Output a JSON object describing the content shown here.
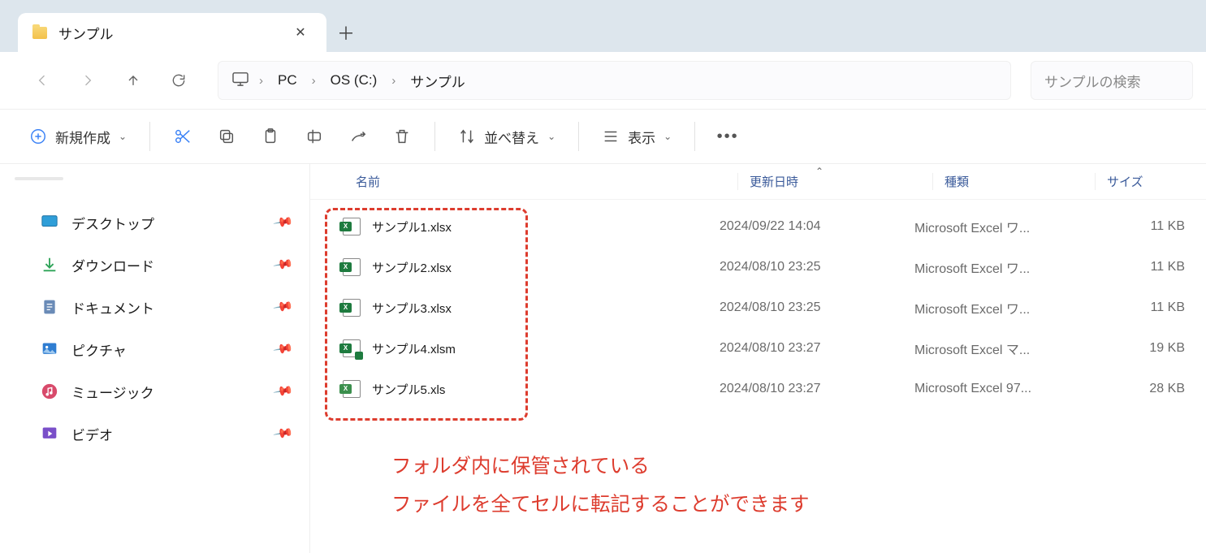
{
  "tab": {
    "title": "サンプル"
  },
  "breadcrumb": {
    "items": [
      "PC",
      "OS (C:)",
      "サンプル"
    ]
  },
  "search": {
    "placeholder": "サンプルの検索"
  },
  "toolbar": {
    "new": "新規作成",
    "sort": "並べ替え",
    "view": "表示"
  },
  "sidebar": {
    "items": [
      {
        "key": "desktop",
        "label": "デスクトップ"
      },
      {
        "key": "downloads",
        "label": "ダウンロード"
      },
      {
        "key": "documents",
        "label": "ドキュメント"
      },
      {
        "key": "pictures",
        "label": "ピクチャ"
      },
      {
        "key": "music",
        "label": "ミュージック"
      },
      {
        "key": "videos",
        "label": "ビデオ"
      }
    ]
  },
  "columns": {
    "name": "名前",
    "date": "更新日時",
    "type": "種類",
    "size": "サイズ"
  },
  "files": [
    {
      "name": "サンプル1.xlsx",
      "date": "2024/09/22 14:04",
      "type": "Microsoft Excel ワ...",
      "size": "11 KB",
      "kind": "xlsx"
    },
    {
      "name": "サンプル2.xlsx",
      "date": "2024/08/10 23:25",
      "type": "Microsoft Excel ワ...",
      "size": "11 KB",
      "kind": "xlsx"
    },
    {
      "name": "サンプル3.xlsx",
      "date": "2024/08/10 23:25",
      "type": "Microsoft Excel ワ...",
      "size": "11 KB",
      "kind": "xlsx"
    },
    {
      "name": "サンプル4.xlsm",
      "date": "2024/08/10 23:27",
      "type": "Microsoft Excel マ...",
      "size": "19 KB",
      "kind": "xlsm"
    },
    {
      "name": "サンプル5.xls",
      "date": "2024/08/10 23:27",
      "type": "Microsoft Excel 97...",
      "size": "28 KB",
      "kind": "xls"
    }
  ],
  "annotation": {
    "line1": "フォルダ内に保管されている",
    "line2": "ファイルを全てセルに転記することができます"
  }
}
